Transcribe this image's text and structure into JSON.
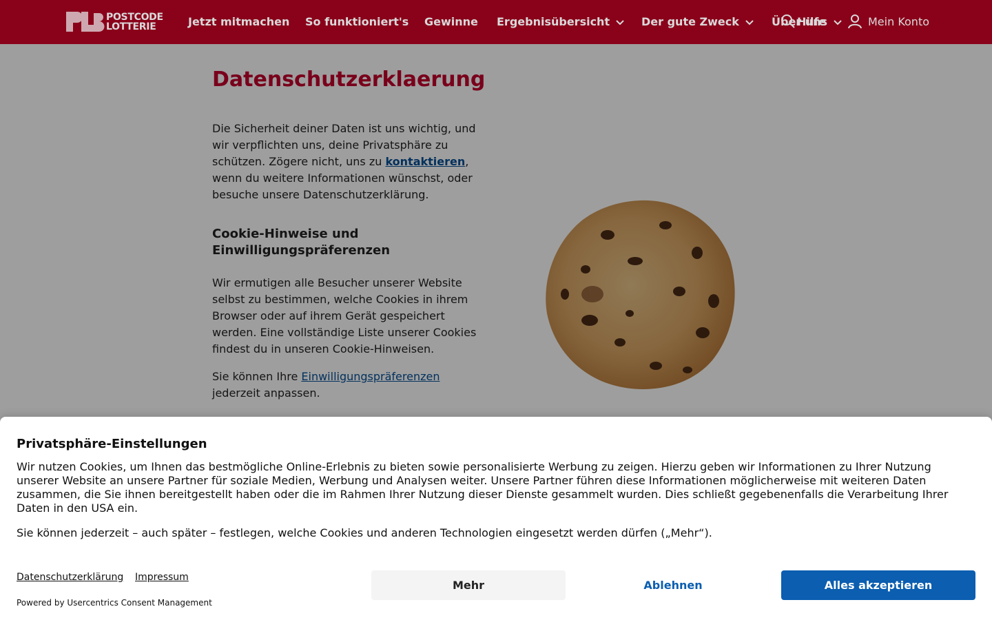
{
  "header": {
    "logo_text_line1": "POSTCODE",
    "logo_text_line2": "LOTTERIE",
    "nav": [
      {
        "label": "Jetzt mitmachen"
      },
      {
        "label": "So funktioniert's"
      },
      {
        "label": "Gewinne"
      },
      {
        "label": "Ergebnisübersicht"
      },
      {
        "label": "Der gute Zweck"
      },
      {
        "label": "Über uns"
      }
    ],
    "hilfe_label": "Hilfe",
    "account_label": "Mein Konto",
    "colors": {
      "brand": "#a3021f"
    }
  },
  "page": {
    "title": "Datenschutzerklaerung",
    "intro_before": "Die Sicherheit deiner Daten ist uns wichtig, und wir verpflichten uns, deine Privatsphäre zu schützen. Zögere nicht, uns zu ",
    "intro_link": "kontaktieren",
    "intro_after": ", wenn du weitere Informationen wünschst, oder besuche unsere Datenschutzerklärung.",
    "subhead": "Cookie-Hinweise und Einwilligungspräferenzen",
    "para2": "Wir ermutigen alle Besucher unserer Website selbst zu bestimmen, welche Cookies in ihrem Browser oder auf ihrem Gerät gespeichert werden. Eine vollständige Liste unserer Cookies findest du in unseren Cookie-Hinweisen.",
    "para3_before": "Sie können Ihre ",
    "para3_link": "Einwilligungspräferenzen",
    "para3_after": " jederzeit anpassen.",
    "image": "cookie-image"
  },
  "consent": {
    "title": "Privatsphäre-Einstellungen",
    "text1": "Wir nutzen Cookies, um Ihnen das bestmögliche Online-Erlebnis zu bieten sowie personalisierte Werbung zu zeigen. Hierzu geben wir Informationen zu Ihrer Nutzung unserer Website an unsere Partner für soziale Medien, Werbung und Analysen weiter. Unsere Partner führen diese Informationen möglicherweise mit weiteren Daten zusammen, die Sie ihnen bereitgestellt haben oder die im Rahmen Ihrer Nutzung dieser Dienste gesammelt wurden. Dies schließt gegebenenfalls die Verarbeitung Ihrer Daten in den USA ein.",
    "text2": "Sie können jederzeit – auch später – festlegen, welche Cookies und anderen Technologien eingesetzt werden dürfen („Mehr“).",
    "link_privacy": "Datenschutzerklärung",
    "link_imprint": "Impressum",
    "powered": "Powered by Usercentrics Consent Management",
    "btn_more": "Mehr",
    "btn_decline": "Ablehnen",
    "btn_accept": "Alles akzeptieren",
    "colors": {
      "primary": "#0b5eb0"
    }
  }
}
